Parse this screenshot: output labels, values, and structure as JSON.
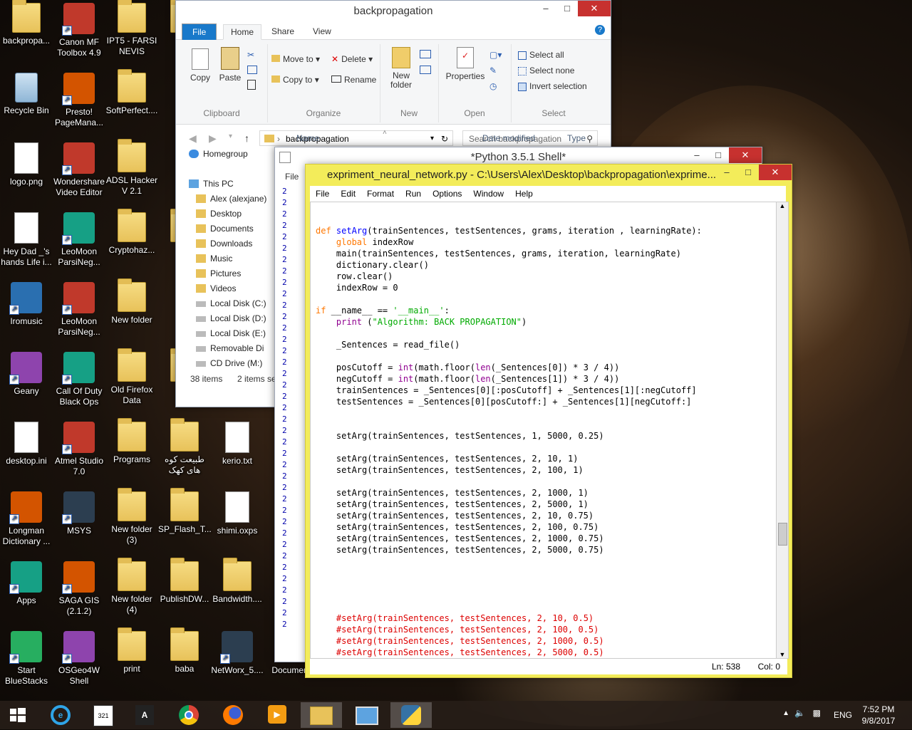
{
  "desktop": {
    "icons": [
      {
        "label": "backpropa...",
        "kind": "folder"
      },
      {
        "label": "Canon MF Toolbox 4.9",
        "kind": "app"
      },
      {
        "label": "IPT5 - FARSI NEVIS",
        "kind": "folder"
      },
      {
        "label": "Bar",
        "kind": "folder"
      },
      {
        "label": "Recycle Bin",
        "kind": "bin"
      },
      {
        "label": "Presto! PageMana...",
        "kind": "app"
      },
      {
        "label": "SoftPerfect....",
        "kind": "folder"
      },
      {
        "label": "logo.png",
        "kind": "file"
      },
      {
        "label": "Wondershare Video Editor",
        "kind": "app"
      },
      {
        "label": "ADSL Hacker V 2.1",
        "kind": "folder"
      },
      {
        "label": "Hey Dad _'s hands Life i...",
        "kind": "file"
      },
      {
        "label": "LeoMoon ParsiNeg...",
        "kind": "app"
      },
      {
        "label": "Cryptohaz...",
        "kind": "folder"
      },
      {
        "label": "Wo",
        "kind": "folder"
      },
      {
        "label": "Iromusic",
        "kind": "app"
      },
      {
        "label": "LeoMoon ParsiNeg...",
        "kind": "app"
      },
      {
        "label": "New folder",
        "kind": "folder"
      },
      {
        "label": "Geany",
        "kind": "app"
      },
      {
        "label": "Call Of Duty Black Ops",
        "kind": "app"
      },
      {
        "label": "Old Firefox Data",
        "kind": "folder"
      },
      {
        "label": "Scr",
        "kind": "folder"
      },
      {
        "label": "desktop.ini",
        "kind": "file"
      },
      {
        "label": "Atmel Studio 7.0",
        "kind": "app"
      },
      {
        "label": "Programs",
        "kind": "folder"
      },
      {
        "label": "طبیعت کوه های کهک",
        "kind": "folder"
      },
      {
        "label": "kerio.txt",
        "kind": "file"
      },
      {
        "label": "Longman Dictionary ...",
        "kind": "app"
      },
      {
        "label": "MSYS",
        "kind": "app"
      },
      {
        "label": "New folder (3)",
        "kind": "folder"
      },
      {
        "label": "SP_Flash_T...",
        "kind": "folder"
      },
      {
        "label": "shimi.oxps",
        "kind": "file"
      },
      {
        "label": "O",
        "kind": "file"
      },
      {
        "label": "Apps",
        "kind": "app"
      },
      {
        "label": "SAGA GIS (2.1.2)",
        "kind": "app"
      },
      {
        "label": "New folder (4)",
        "kind": "folder"
      },
      {
        "label": "PublishDW...",
        "kind": "folder"
      },
      {
        "label": "Bandwidth....",
        "kind": "folder"
      },
      {
        "label": "Start BlueStacks",
        "kind": "app"
      },
      {
        "label": "OSGeo4W Shell",
        "kind": "app"
      },
      {
        "label": "print",
        "kind": "folder"
      },
      {
        "label": "baba",
        "kind": "folder"
      },
      {
        "label": "NetWorx_5....",
        "kind": "app"
      },
      {
        "label": "Documen",
        "kind": "file"
      }
    ]
  },
  "explorer": {
    "title": "backpropagation",
    "tabs": [
      "File",
      "Home",
      "Share",
      "View"
    ],
    "clipboard": {
      "copy": "Copy",
      "paste": "Paste",
      "label": "Clipboard"
    },
    "organize": {
      "move_to": "Move to",
      "copy_to": "Copy to",
      "delete": "Delete",
      "rename": "Rename",
      "label": "Organize"
    },
    "new": {
      "new_folder": "New folder",
      "label": "New"
    },
    "open": {
      "properties": "Properties",
      "label": "Open"
    },
    "select": {
      "select_all": "Select all",
      "select_none": "Select none",
      "invert": "Invert selection",
      "label": "Select"
    },
    "address": "backpropagation",
    "search_placeholder": "Search backpropagation",
    "columns": {
      "name": "Name",
      "date": "Date modified",
      "type": "Type"
    },
    "nav": [
      "Homegroup",
      "This PC",
      "Alex (alexjane)",
      "Desktop",
      "Documents",
      "Downloads",
      "Music",
      "Pictures",
      "Videos",
      "Local Disk (C:)",
      "Local Disk (D:)",
      "Local Disk (E:)",
      "Removable Di",
      "CD Drive (M:)"
    ],
    "status_items": "38 items",
    "status_selected": "2 items se"
  },
  "shell": {
    "title": "*Python 3.5.1 Shell*",
    "menu_file": "File",
    "line_marker": "2"
  },
  "editor": {
    "title": "expriment_neural_network.py - C:\\Users\\Alex\\Desktop\\backpropagation\\exprime...",
    "menu": [
      "File",
      "Edit",
      "Format",
      "Run",
      "Options",
      "Window",
      "Help"
    ],
    "status_ln": "Ln: 538",
    "status_col": "Col: 0"
  },
  "taskbar": {
    "time": "7:52 PM",
    "date": "9/8/2017",
    "lang": "ENG"
  }
}
